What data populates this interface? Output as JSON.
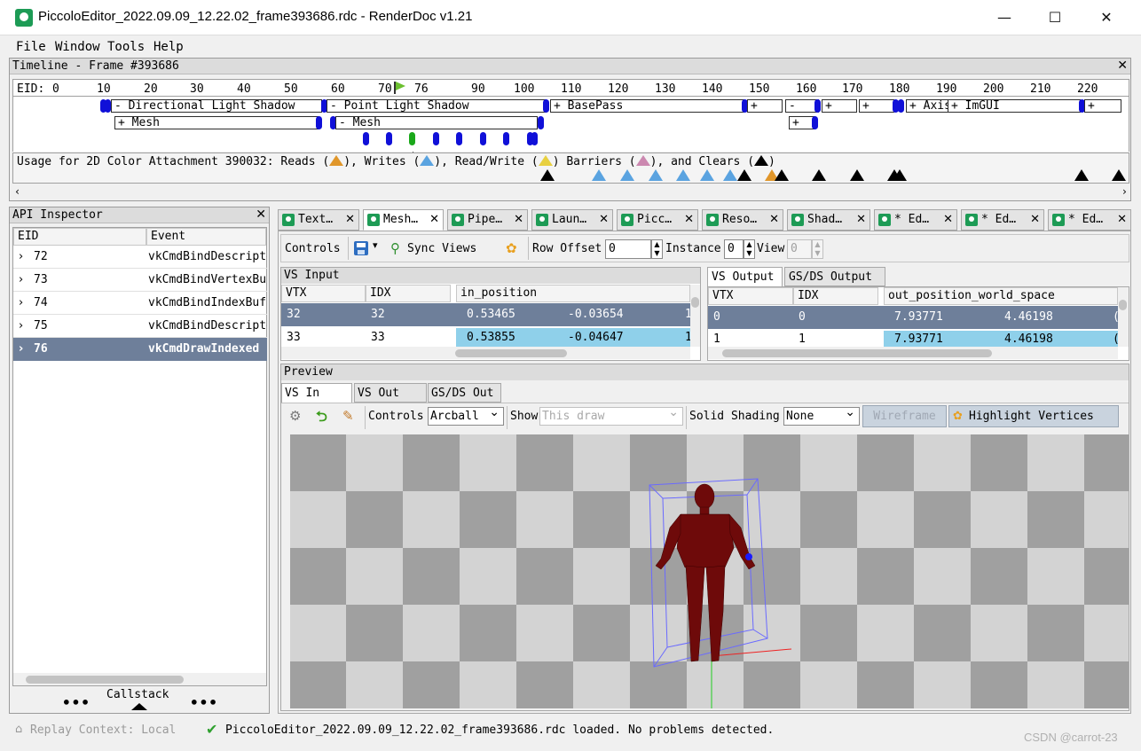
{
  "window": {
    "title": "PiccoloEditor_2022.09.09_12.22.02_frame393686.rdc - RenderDoc v1.21",
    "min": "—",
    "max": "☐",
    "close": "✕"
  },
  "menu": [
    "File",
    "Window",
    "Tools",
    "Help"
  ],
  "timeline": {
    "title": "Timeline - Frame #393686",
    "eid_label": "EID:",
    "ticks": [
      "0",
      "10",
      "20",
      "30",
      "40",
      "50",
      "60",
      "70",
      "76",
      "90",
      "100",
      "110",
      "120",
      "130",
      "140",
      "150",
      "160",
      "170",
      "180",
      "190",
      "200",
      "210",
      "220"
    ],
    "markers": [
      "- Directional Light Shadow",
      "- Point Light Shadow",
      "+ BasePass",
      "+",
      "-",
      "+",
      "+",
      "+ Axis",
      "+ ImGUI",
      "+"
    ],
    "sub_markers": [
      "+ Mesh",
      "- Mesh",
      "+"
    ],
    "usage": "Usage for 2D Color Attachment 390032: Reads (",
    "usage_writes": "), Writes (",
    "usage_rw": "), Read/Write (",
    "usage_barriers": ") Barriers (",
    "usage_clears": "), and Clears (",
    "usage_end": ")"
  },
  "api_inspector": {
    "title": "API Inspector",
    "col_eid": "EID",
    "col_event": "Event",
    "rows": [
      {
        "eid": "72",
        "event": "vkCmdBindDescripto"
      },
      {
        "eid": "73",
        "event": "vkCmdBindVertexBuf"
      },
      {
        "eid": "74",
        "event": "vkCmdBindIndexBuff"
      },
      {
        "eid": "75",
        "event": "vkCmdBindDescripto"
      },
      {
        "eid": "76",
        "event": "vkCmdDrawIndexed"
      }
    ],
    "callstack": "Callstack",
    "dots": "•••"
  },
  "tabs": [
    "Text…",
    "Mesh…",
    "Pipe…",
    "Laun…",
    "Picc…",
    "Reso…",
    "Shad…",
    "* Ed…",
    "* Ed…",
    "* Ed…"
  ],
  "toolbar": {
    "controls": "Controls",
    "sync": "Sync Views",
    "row_offset_label": "Row Offset",
    "row_offset": "0",
    "instance_label": "Instance",
    "instance": "0",
    "view_label": "View",
    "view": "0"
  },
  "vs_input": {
    "title": "VS Input",
    "cols": [
      "VTX",
      "IDX",
      "in_position"
    ],
    "rows": [
      [
        "32",
        "32",
        "0.53465",
        "-0.03654",
        "1"
      ],
      [
        "33",
        "33",
        "0.53855",
        "-0.04647",
        "1"
      ]
    ]
  },
  "vs_output": {
    "tabs": [
      "VS Output",
      "GS/DS Output"
    ],
    "cols": [
      "VTX",
      "IDX",
      "out_position_world_space"
    ],
    "rows": [
      [
        "0",
        "0",
        "7.93771",
        "4.46198",
        "("
      ],
      [
        "1",
        "1",
        "7.93771",
        "4.46198",
        "("
      ]
    ]
  },
  "preview": {
    "title": "Preview",
    "tabs": [
      "VS In",
      "VS Out",
      "GS/DS Out"
    ],
    "controls_label": "Controls",
    "controls_value": "Arcball",
    "show_label": "Show",
    "show_value": "This draw",
    "solid_label": "Solid Shading",
    "solid_value": "None",
    "wireframe": "Wireframe",
    "highlight": "Highlight Vertices"
  },
  "status": {
    "replay": "Replay Context: Local",
    "message": "PiccoloEditor_2022.09.09_12.22.02_frame393686.rdc loaded. No problems detected.",
    "watermark": "CSDN @carrot-23"
  },
  "colors": {
    "selected_row": "#6e7f9a",
    "highlight_cell": "#8fd0ea",
    "mesh": "#6e0a0a",
    "bbox": "#6a6aff"
  }
}
